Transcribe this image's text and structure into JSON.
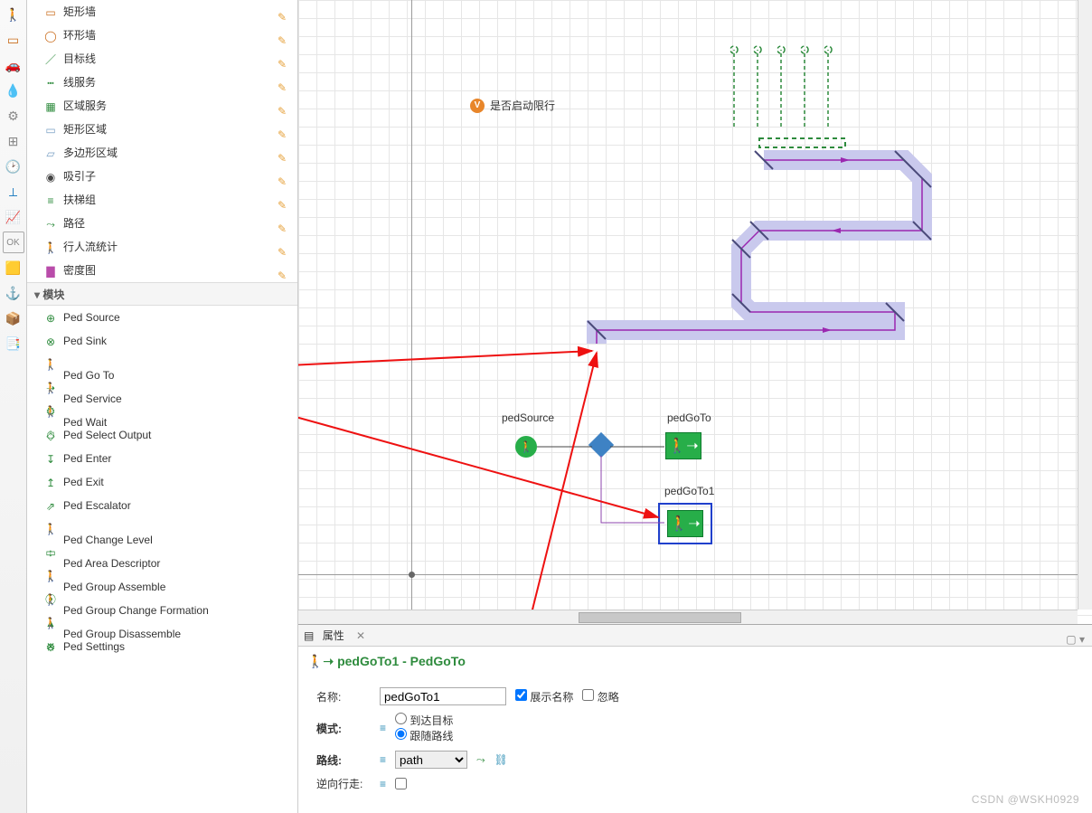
{
  "left_tool_icons": [
    "🔳",
    "🔲",
    "🔶",
    "🚗",
    "💧",
    "⚙",
    "⊞",
    "🕑",
    "⟂",
    "📈",
    "OK",
    "🟨",
    "⚓",
    "📦",
    "📑"
  ],
  "palette_items_top": [
    {
      "icon": "▭",
      "label": "矩形墙",
      "color": "#c96b1a",
      "pencil": true
    },
    {
      "icon": "◯",
      "label": "环形墙",
      "color": "#c96b1a",
      "pencil": true
    },
    {
      "icon": "／",
      "label": "目标线",
      "color": "#2e8b3d",
      "pencil": true
    },
    {
      "icon": "┅",
      "label": "线服务",
      "color": "#2e8b3d",
      "pencil": true
    },
    {
      "icon": "▦",
      "label": "区域服务",
      "color": "#2e8b3d",
      "pencil": true
    },
    {
      "icon": "▭",
      "label": "矩形区域",
      "color": "#7aa0c4",
      "pencil": true
    },
    {
      "icon": "▱",
      "label": "多边形区域",
      "color": "#7aa0c4",
      "pencil": true
    },
    {
      "icon": "◉",
      "label": "吸引子",
      "color": "#444",
      "pencil": true
    },
    {
      "icon": "≡",
      "label": "扶梯组",
      "color": "#2e8b3d",
      "pencil": true
    },
    {
      "icon": "⤳",
      "label": "路径",
      "color": "#2e8b3d",
      "pencil": true
    },
    {
      "icon": "🚶",
      "label": "行人流统计",
      "color": "#2e8b3d",
      "pencil": true
    },
    {
      "icon": "▇",
      "label": "密度图",
      "color": "#b94caa",
      "pencil": true
    }
  ],
  "section_label": "模块",
  "palette_modules": [
    {
      "icon": "⊕",
      "label": "Ped Source"
    },
    {
      "icon": "⊗",
      "label": "Ped Sink"
    },
    {
      "icon": "🚶➝",
      "label": "Ped Go To"
    },
    {
      "icon": "🚶⚙",
      "label": "Ped Service"
    },
    {
      "icon": "🚶⏱",
      "label": "Ped Wait"
    },
    {
      "icon": "◇",
      "label": "Ped Select Output"
    },
    {
      "icon": "↧",
      "label": "Ped Enter"
    },
    {
      "icon": "↥",
      "label": "Ped Exit"
    },
    {
      "icon": "⇗",
      "label": "Ped Escalator"
    },
    {
      "icon": "🚶↕",
      "label": "Ped Change Level"
    },
    {
      "icon": "▭🚶",
      "label": "Ped Area Descriptor"
    },
    {
      "icon": "🚶⦿",
      "label": "Ped Group Assemble"
    },
    {
      "icon": "🚶▲",
      "label": "Ped Group Change Formation"
    },
    {
      "icon": "🚶✕",
      "label": "Ped Group Disassemble"
    },
    {
      "icon": "⚙",
      "label": "Ped Settings"
    }
  ],
  "canvas": {
    "annotation_badge": "V",
    "annotation_text": "是否启动限行",
    "pedSource_label": "pedSource",
    "pedGoTo_label": "pedGoTo",
    "pedGoTo1_label": "pedGoTo1"
  },
  "props_tab": "属性",
  "props_title": "pedGoTo1 - PedGoTo",
  "props": {
    "name_label": "名称:",
    "name_value": "pedGoTo1",
    "show_name_label": "展示名称",
    "ignore_label": "忽略",
    "mode_label": "模式:",
    "mode_opt1": "到达目标",
    "mode_opt2": "跟随路线",
    "route_label": "路线:",
    "route_value": "path",
    "reverse_label": "逆向行走:"
  },
  "watermark": "CSDN @WSKH0929"
}
